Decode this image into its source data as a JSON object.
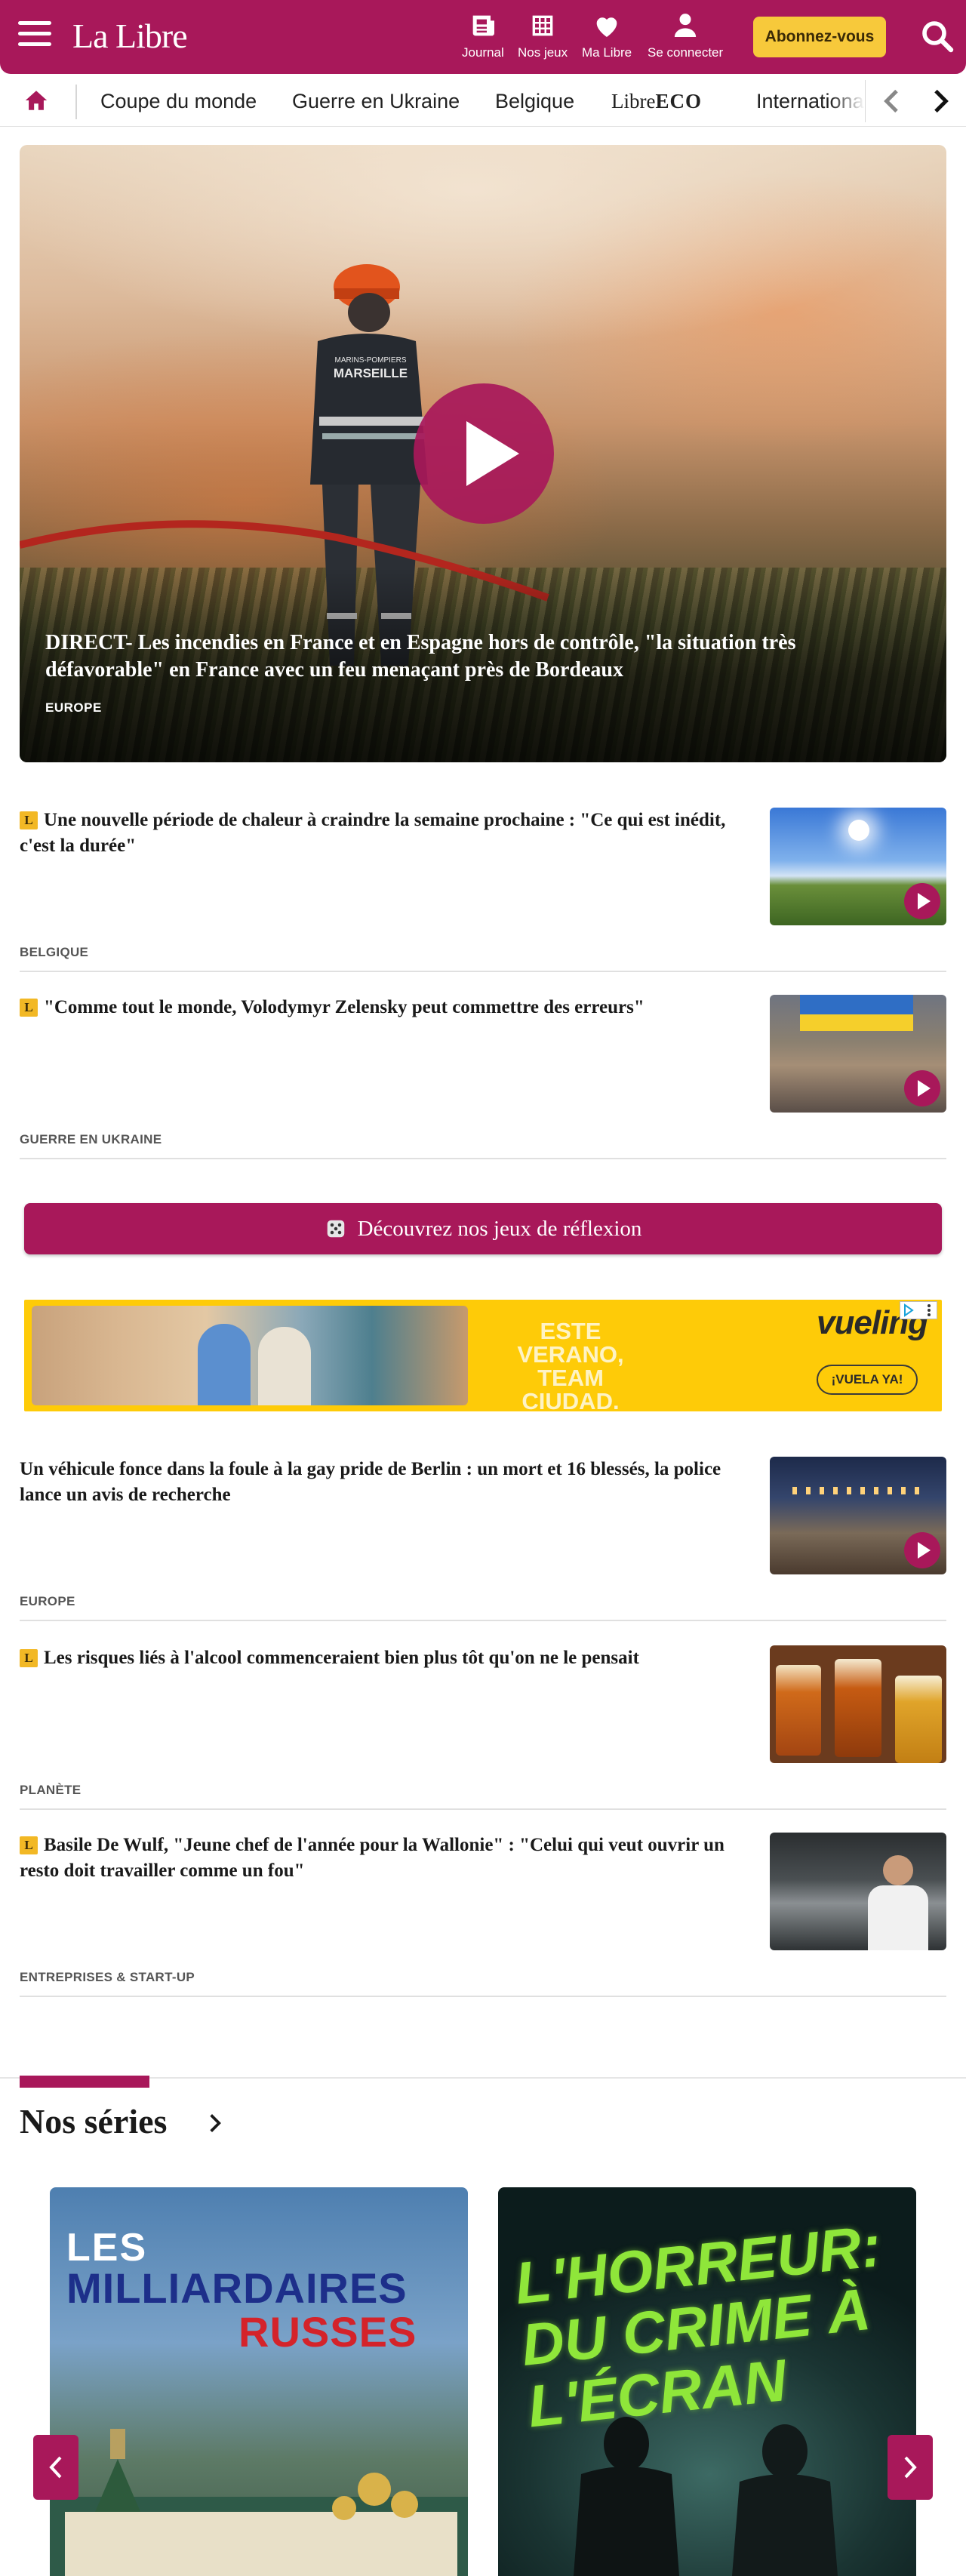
{
  "header": {
    "logo": "La Libre",
    "nav": [
      {
        "label": "Journal",
        "icon": "newspaper-icon"
      },
      {
        "label": "Nos jeux",
        "icon": "puzzle-icon"
      },
      {
        "label": "Ma Libre",
        "icon": "heart-icon"
      },
      {
        "label": "Se connecter",
        "icon": "user-icon"
      }
    ],
    "subscribe_label": "Abonnez-vous",
    "colors": {
      "brand": "#a8185a",
      "subscribe": "#f7c93b"
    }
  },
  "categories": {
    "items": [
      "Coupe du monde",
      "Guerre en Ukraine",
      "Belgique"
    ],
    "eco_prefix": "Libre",
    "eco_suffix": "ECO",
    "last_item": "International"
  },
  "hero": {
    "title": "DIRECT- Les incendies en France et en Espagne hors de contrôle, \"la situation très défavorable\" en France avec un feu menaçant près de Bordeaux",
    "tag": "EUROPE",
    "helmet_text_1": "MARINS-POMPIERS",
    "helmet_text_2": "MARSEILLE"
  },
  "articles": [
    {
      "premium": "L",
      "title": "Une nouvelle période de chaleur à craindre la semaine prochaine : \"Ce qui est inédit, c'est la durée\"",
      "tag": "BELGIQUE",
      "video": true
    },
    {
      "premium": "L",
      "title": "\"Comme tout le monde, Volodymyr Zelensky peut commettre des erreurs\"",
      "tag": "GUERRE EN UKRAINE",
      "video": true
    },
    {
      "premium": "",
      "title": "Un véhicule fonce dans la foule à la gay pride de Berlin : un mort et 16 blessés, la police lance un avis de recherche",
      "tag": "EUROPE",
      "video": true
    },
    {
      "premium": "L",
      "title": "Les risques liés à l'alcool commenceraient bien plus tôt qu'on ne le pensait",
      "tag": "PLANÈTE",
      "video": false
    },
    {
      "premium": "L",
      "title": "Basile De Wulf, \"Jeune chef de l'année pour la Wallonie\" : \"Celui qui veut ouvrir un resto doit travailler comme un fou\"",
      "tag": "ENTREPRISES & START-UP",
      "video": false
    }
  ],
  "games_button": {
    "label": "Découvrez nos jeux de réflexion"
  },
  "ad": {
    "line1": "ESTE VERANO,",
    "line2": "TEAM",
    "line3": "CIUDAD.",
    "brand": "vueling",
    "cta": "¡VUELA YA!"
  },
  "series": {
    "title": "Nos séries",
    "cards": [
      {
        "line1": "LES",
        "line2": "MILLIARDAIRES",
        "line3": "RUSSES"
      },
      {
        "text": "L'HORREUR: DU CRIME À L'ÉCRAN"
      }
    ]
  }
}
